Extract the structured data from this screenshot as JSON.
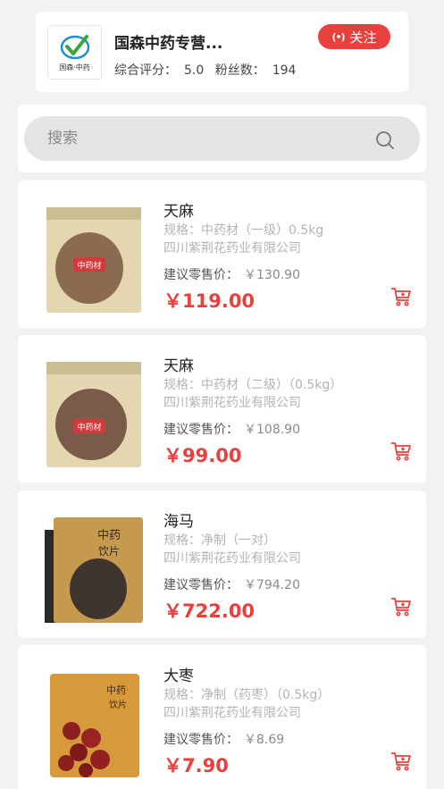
{
  "store": {
    "name": "国森中药专营...",
    "logo_text": "国森·中药",
    "rating_label": "综合评分：",
    "rating_value": "5.0",
    "fans_label": "粉丝数：",
    "fans_value": "194",
    "follow_label": "关注",
    "follow_icon": "(•)"
  },
  "search": {
    "placeholder": "搜索"
  },
  "products": [
    {
      "name": "天麻",
      "spec": "规格：中药材（一级）0.5kg",
      "company": "四川紫荆花药业有限公司",
      "retail_label": "建议零售价：",
      "retail_price": "￥130.90",
      "price": "￥119.00",
      "package_color": "#8a6b52"
    },
    {
      "name": "天麻",
      "spec": "规格：中药材（二级）（0.5kg）",
      "company": "四川紫荆花药业有限公司",
      "retail_label": "建议零售价：",
      "retail_price": "￥108.90",
      "price": "￥99.00",
      "package_color": "#7a5a48"
    },
    {
      "name": "海马",
      "spec": "规格：净制（一对）",
      "company": "四川紫荆花药业有限公司",
      "retail_label": "建议零售价：",
      "retail_price": "￥794.20",
      "price": "￥722.00",
      "package_color": "#c59a4e"
    },
    {
      "name": "大枣",
      "spec": "规格：净制（药枣）（0.5kg）",
      "company": "四川紫荆花药业有限公司",
      "retail_label": "建议零售价：",
      "retail_price": "￥8.69",
      "price": "￥7.90",
      "package_color": "#d69a3a"
    }
  ],
  "colors": {
    "accent": "#e8403c",
    "background": "#f2f2f2"
  }
}
